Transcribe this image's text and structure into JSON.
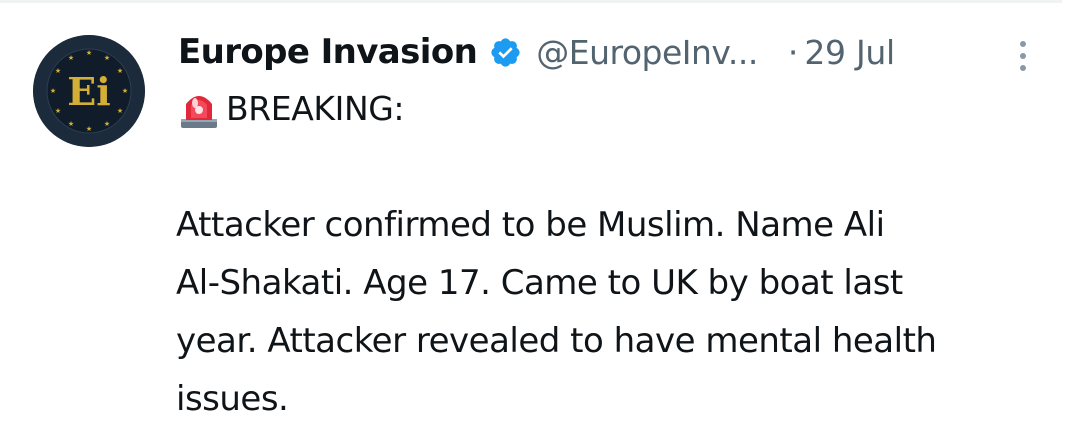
{
  "tweet": {
    "author": {
      "display_name": "Europe Invasion",
      "verified": true,
      "handle": "@EuropeInv...",
      "avatar_text": "Ei"
    },
    "separator": "·",
    "timestamp": "29 Jul",
    "breaking_emoji": "siren-icon",
    "breaking_label": "BREAKING:",
    "body": "Attacker confirmed to be Muslim. Name Ali\nAl-Shakati. Age 17. Came to UK by boat last\nyear. Attacker revealed to have mental health\nissues."
  },
  "colors": {
    "text_primary": "#0f1419",
    "text_secondary": "#536471",
    "verified_blue": "#1d9bf0",
    "avatar_bg": "#1c2b3c",
    "avatar_gold": "#d4af37"
  }
}
